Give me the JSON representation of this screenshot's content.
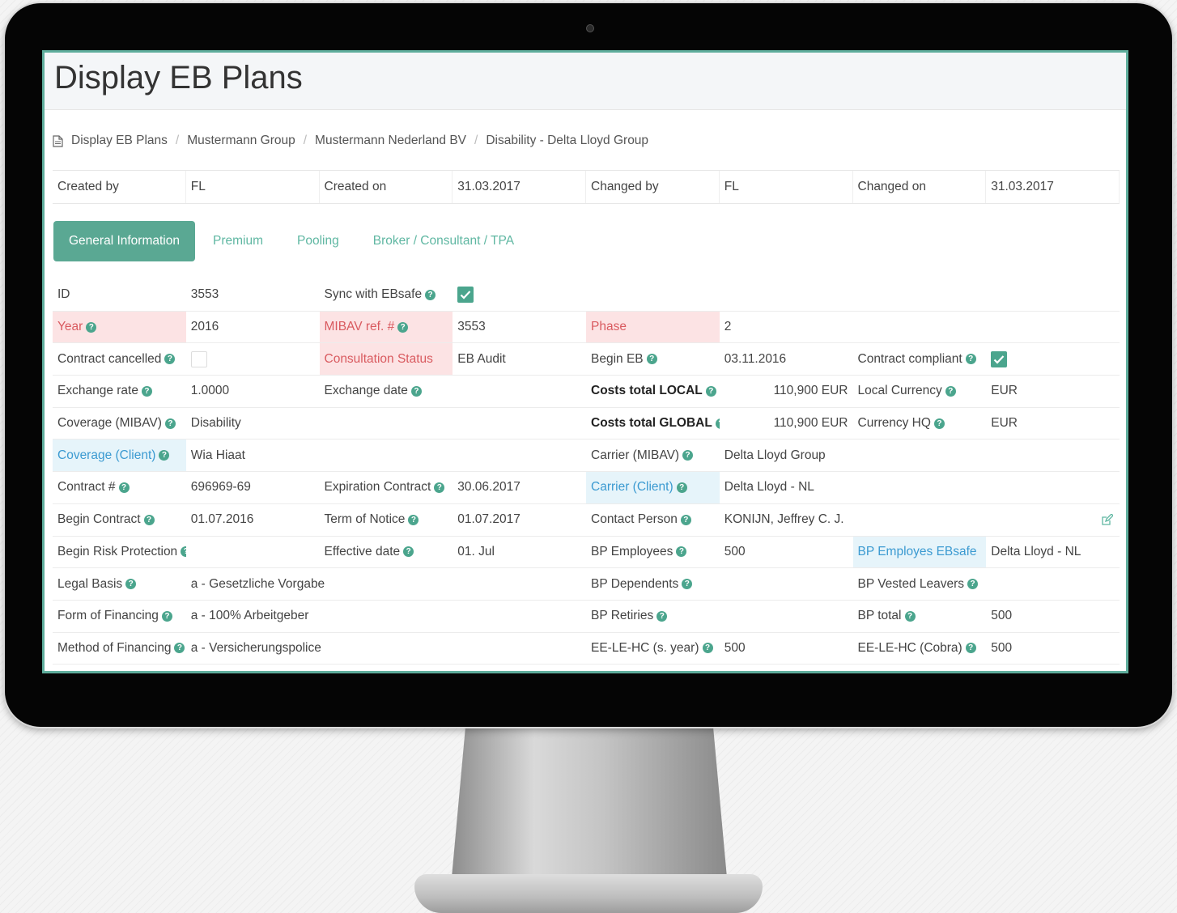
{
  "page": {
    "title": "Display EB Plans",
    "breadcrumb": [
      "Display EB Plans",
      "Mustermann Group",
      "Mustermann Nederland BV",
      "Disability - Delta Lloyd Group"
    ]
  },
  "meta": [
    {
      "label": "Created by",
      "value": "FL"
    },
    {
      "label": "Created on",
      "value": "31.03.2017"
    },
    {
      "label": "Changed by",
      "value": "FL"
    },
    {
      "label": "Changed on",
      "value": "31.03.2017"
    }
  ],
  "tabs": [
    "General Information",
    "Premium",
    "Pooling",
    "Broker / Consultant / TPA"
  ],
  "active_tab": "General Information",
  "icons": {
    "help": "question-circle-icon",
    "breadcrumb": "document-icon",
    "edit": "edit-icon"
  },
  "colors": {
    "accent": "#5aa893",
    "required_bg": "#fce3e4",
    "required_text": "#d95a5f",
    "link_bg": "#e6f4fa",
    "link_text": "#3b9ad1"
  },
  "form": {
    "id_label": "ID",
    "id": "3553",
    "sync_label": "Sync with EBsafe",
    "sync_checked": true,
    "year_label": "Year",
    "year": "2016",
    "mibav_ref_label": "MIBAV ref. #",
    "mibav_ref": "3553",
    "phase_label": "Phase",
    "phase": "2",
    "contract_cancelled_label": "Contract cancelled",
    "contract_cancelled": false,
    "consultation_status_label": "Consultation Status",
    "consultation_status": "EB Audit",
    "begin_eb_label": "Begin EB",
    "begin_eb": "03.11.2016",
    "contract_compliant_label": "Contract compliant",
    "contract_compliant": true,
    "exchange_rate_label": "Exchange rate",
    "exchange_rate": "1.0000",
    "exchange_date_label": "Exchange date",
    "exchange_date": "",
    "costs_local_label": "Costs total LOCAL",
    "costs_local": "110,900",
    "costs_local_currency": "EUR",
    "local_currency_label": "Local Currency",
    "local_currency": "EUR",
    "coverage_mibav_label": "Coverage (MIBAV)",
    "coverage_mibav": "Disability",
    "costs_global_label": "Costs total GLOBAL",
    "costs_global": "110,900",
    "costs_global_currency": "EUR",
    "currency_hq_label": "Currency HQ",
    "currency_hq": "EUR",
    "coverage_client_label": "Coverage (Client)",
    "coverage_client": "Wia Hiaat",
    "carrier_mibav_label": "Carrier (MIBAV)",
    "carrier_mibav": "Delta Lloyd Group",
    "contract_no_label": "Contract #",
    "contract_no": "696969-69",
    "expiration_contract_label": "Expiration Contract",
    "expiration_contract": "30.06.2017",
    "carrier_client_label": "Carrier (Client)",
    "carrier_client": "Delta Lloyd - NL",
    "begin_contract_label": "Begin Contract",
    "begin_contract": "01.07.2016",
    "term_notice_label": "Term of Notice",
    "term_notice": "01.07.2017",
    "contact_person_label": "Contact Person",
    "contact_person": "KONIJN, Jeffrey C. J.",
    "begin_risk_label": "Begin Risk Protection",
    "begin_risk": "",
    "effective_date_label": "Effective date",
    "effective_date": "01. Jul",
    "bp_employees_label": "BP Employees",
    "bp_employees": "500",
    "bp_employes_ebsafe_label": "BP Employes EBsafe",
    "bp_employes_ebsafe": "Delta Lloyd - NL",
    "legal_basis_label": "Legal Basis",
    "legal_basis": "a - Gesetzliche Vorgabe",
    "bp_dependents_label": "BP Dependents",
    "bp_dependents": "",
    "bp_vested_leavers_label": "BP Vested Leavers",
    "bp_vested_leavers": "",
    "form_financing_label": "Form of Financing",
    "form_financing": "a - 100% Arbeitgeber",
    "bp_retiries_label": "BP Retiries",
    "bp_retiries": "",
    "bp_total_label": "BP total",
    "bp_total": "500",
    "method_financing_label": "Method of Financing",
    "method_financing": "a - Versicherungspolice",
    "ee_le_hc_year_label": "EE-LE-HC (s. year)",
    "ee_le_hc_year": "500",
    "ee_le_hc_cobra_label": "EE-LE-HC (Cobra)",
    "ee_le_hc_cobra": "500"
  }
}
